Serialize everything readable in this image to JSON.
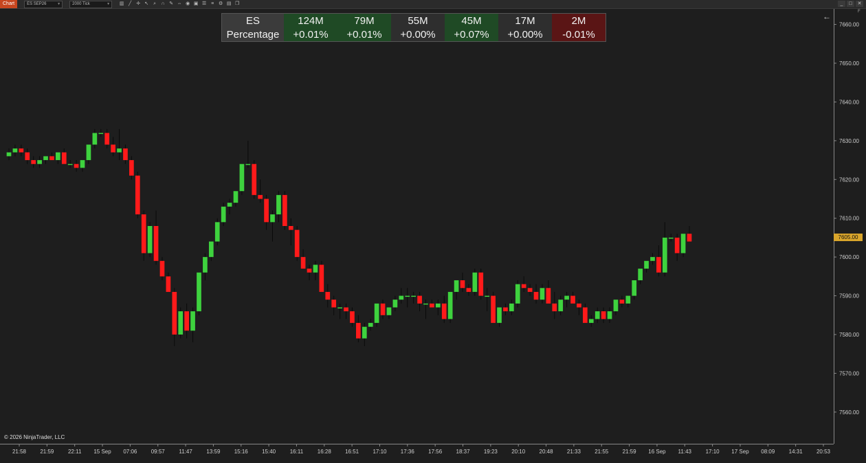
{
  "toolbar": {
    "tab": "Chart",
    "instrument": "ES SEP26",
    "interval": "2000 Tick",
    "icons": [
      "bar-chart-icon",
      "trend-icon",
      "crosshair-icon",
      "pointer-icon",
      "zoom-icon",
      "magnet-icon",
      "draw-icon",
      "measure-icon",
      "global-icon",
      "snapshot-icon",
      "properties-icon",
      "list-icon",
      "strategy-icon",
      "dom-icon",
      "window-icon"
    ],
    "window_controls": [
      "_",
      "□",
      "✕"
    ]
  },
  "stats_table": {
    "header": [
      "ES",
      "124M",
      "79M",
      "55M",
      "45M",
      "17M",
      "2M"
    ],
    "row_label": "Percentage",
    "values": [
      "+0.01%",
      "+0.01%",
      "+0.00%",
      "+0.07%",
      "+0.00%",
      "-0.01%"
    ],
    "colors": [
      "#1f4a25",
      "#1f4a25",
      "#2e2e2e",
      "#1f4a25",
      "#2e2e2e",
      "#5a1515"
    ]
  },
  "copyright": "© 2026 NinjaTrader, LLC",
  "price_badge": "7605.00",
  "chart_data": {
    "type": "candlestick",
    "up_color": "#3ed23e",
    "down_color": "#ff1a1a",
    "ylim": [
      7552,
      7664
    ],
    "y_ticks": [
      7660,
      7650,
      7640,
      7630,
      7620,
      7610,
      7600,
      7590,
      7580,
      7570,
      7560
    ],
    "y_tick_labels": [
      "7660.00",
      "7650.00",
      "7640.00",
      "7630.00",
      "7620.00",
      "7610.00",
      "7600.00",
      "7590.00",
      "7580.00",
      "7570.00",
      "7560.00"
    ],
    "x_labels": [
      "21:58",
      "21:59",
      "22:11",
      "15 Sep",
      "07:06",
      "09:57",
      "11:47",
      "13:59",
      "15:16",
      "15:40",
      "16:11",
      "16:28",
      "16:51",
      "17:10",
      "17:36",
      "17:56",
      "18:37",
      "19:23",
      "20:10",
      "20:48",
      "21:33",
      "21:55",
      "21:59",
      "16 Sep",
      "11:43",
      "17:10",
      "17 Sep",
      "08:09",
      "14:31",
      "20:53"
    ],
    "last_price": 7605,
    "candles": [
      [
        7626,
        7628,
        7625,
        7627
      ],
      [
        7627,
        7629,
        7626,
        7628
      ],
      [
        7628,
        7629,
        7626,
        7627
      ],
      [
        7627,
        7628,
        7624,
        7625
      ],
      [
        7625,
        7626,
        7623,
        7624
      ],
      [
        7624,
        7626,
        7623,
        7625
      ],
      [
        7625,
        7626,
        7624,
        7626
      ],
      [
        7626,
        7627,
        7625,
        7625
      ],
      [
        7625,
        7627,
        7624,
        7627
      ],
      [
        7627,
        7628,
        7624,
        7624
      ],
      [
        7624,
        7625,
        7623,
        7624
      ],
      [
        7624,
        7625,
        7622,
        7623
      ],
      [
        7623,
        7625,
        7622,
        7625
      ],
      [
        7625,
        7629,
        7624,
        7629
      ],
      [
        7629,
        7633,
        7628,
        7632
      ],
      [
        7632,
        7633,
        7631,
        7632
      ],
      [
        7632,
        7633,
        7628,
        7629
      ],
      [
        7629,
        7631,
        7626,
        7627
      ],
      [
        7627,
        7633,
        7625,
        7628
      ],
      [
        7628,
        7629,
        7624,
        7625
      ],
      [
        7625,
        7626,
        7620,
        7621
      ],
      [
        7621,
        7622,
        7610,
        7611
      ],
      [
        7611,
        7612,
        7599,
        7601
      ],
      [
        7601,
        7609,
        7600,
        7608
      ],
      [
        7608,
        7612,
        7598,
        7599
      ],
      [
        7599,
        7600,
        7594,
        7595
      ],
      [
        7595,
        7596,
        7591,
        7591
      ],
      [
        7591,
        7592,
        7577,
        7580
      ],
      [
        7580,
        7587,
        7579,
        7586
      ],
      [
        7586,
        7588,
        7579,
        7581
      ],
      [
        7581,
        7587,
        7578,
        7586
      ],
      [
        7586,
        7596,
        7585,
        7596
      ],
      [
        7596,
        7601,
        7594,
        7600
      ],
      [
        7600,
        7604,
        7599,
        7604
      ],
      [
        7604,
        7610,
        7603,
        7609
      ],
      [
        7609,
        7614,
        7608,
        7613
      ],
      [
        7613,
        7615,
        7611,
        7614
      ],
      [
        7614,
        7617,
        7613,
        7617
      ],
      [
        7617,
        7624,
        7616,
        7624
      ],
      [
        7624,
        7630,
        7623,
        7624
      ],
      [
        7624,
        7625,
        7615,
        7616
      ],
      [
        7616,
        7620,
        7614,
        7615
      ],
      [
        7615,
        7616,
        7607,
        7609
      ],
      [
        7609,
        7612,
        7604,
        7611
      ],
      [
        7611,
        7617,
        7609,
        7616
      ],
      [
        7616,
        7617,
        7607,
        7608
      ],
      [
        7608,
        7610,
        7603,
        7607
      ],
      [
        7607,
        7608,
        7599,
        7600
      ],
      [
        7600,
        7602,
        7597,
        7597
      ],
      [
        7597,
        7598,
        7594,
        7596
      ],
      [
        7596,
        7599,
        7594,
        7598
      ],
      [
        7598,
        7599,
        7591,
        7591
      ],
      [
        7591,
        7593,
        7587,
        7589
      ],
      [
        7589,
        7590,
        7585,
        7587
      ],
      [
        7587,
        7588,
        7584,
        7587
      ],
      [
        7587,
        7588,
        7584,
        7586
      ],
      [
        7586,
        7587,
        7582,
        7583
      ],
      [
        7583,
        7585,
        7578,
        7579
      ],
      [
        7579,
        7583,
        7577,
        7582
      ],
      [
        7582,
        7584,
        7581,
        7583
      ],
      [
        7583,
        7588,
        7582,
        7588
      ],
      [
        7588,
        7589,
        7584,
        7585
      ],
      [
        7585,
        7587,
        7584,
        7587
      ],
      [
        7587,
        7590,
        7586,
        7589
      ],
      [
        7589,
        7592,
        7588,
        7590
      ],
      [
        7590,
        7592,
        7587,
        7590
      ],
      [
        7590,
        7591,
        7588,
        7590
      ],
      [
        7590,
        7591,
        7586,
        7588
      ],
      [
        7588,
        7589,
        7584,
        7588
      ],
      [
        7588,
        7589,
        7587,
        7587
      ],
      [
        7587,
        7589,
        7585,
        7588
      ],
      [
        7588,
        7590,
        7583,
        7584
      ],
      [
        7584,
        7591,
        7583,
        7591
      ],
      [
        7591,
        7594,
        7589,
        7594
      ],
      [
        7594,
        7596,
        7591,
        7592
      ],
      [
        7592,
        7593,
        7590,
        7591
      ],
      [
        7591,
        7597,
        7590,
        7596
      ],
      [
        7596,
        7597,
        7589,
        7590
      ],
      [
        7590,
        7592,
        7586,
        7590
      ],
      [
        7590,
        7591,
        7583,
        7583
      ],
      [
        7583,
        7587,
        7582,
        7587
      ],
      [
        7587,
        7588,
        7585,
        7586
      ],
      [
        7586,
        7589,
        7585,
        7588
      ],
      [
        7588,
        7594,
        7587,
        7593
      ],
      [
        7593,
        7595,
        7591,
        7592
      ],
      [
        7592,
        7593,
        7590,
        7591
      ],
      [
        7591,
        7593,
        7588,
        7589
      ],
      [
        7589,
        7593,
        7588,
        7592
      ],
      [
        7592,
        7594,
        7590,
        7588
      ],
      [
        7588,
        7591,
        7584,
        7586
      ],
      [
        7586,
        7590,
        7585,
        7589
      ],
      [
        7589,
        7591,
        7587,
        7590
      ],
      [
        7590,
        7591,
        7588,
        7588
      ],
      [
        7588,
        7589,
        7585,
        7587
      ],
      [
        7587,
        7588,
        7583,
        7583
      ],
      [
        7583,
        7585,
        7582,
        7584
      ],
      [
        7584,
        7587,
        7583,
        7586
      ],
      [
        7586,
        7587,
        7583,
        7584
      ],
      [
        7584,
        7587,
        7583,
        7586
      ],
      [
        7586,
        7589,
        7585,
        7589
      ],
      [
        7589,
        7590,
        7587,
        7588
      ],
      [
        7588,
        7590,
        7587,
        7590
      ],
      [
        7590,
        7594,
        7589,
        7594
      ],
      [
        7594,
        7597,
        7593,
        7597
      ],
      [
        7597,
        7599,
        7596,
        7599
      ],
      [
        7599,
        7601,
        7598,
        7600
      ],
      [
        7600,
        7603,
        7595,
        7596
      ],
      [
        7596,
        7609,
        7595,
        7605
      ],
      [
        7605,
        7606,
        7604,
        7605
      ],
      [
        7605,
        7606,
        7599,
        7601
      ],
      [
        7601,
        7606,
        7600,
        7606
      ],
      [
        7606,
        7608,
        7604,
        7604
      ]
    ]
  }
}
